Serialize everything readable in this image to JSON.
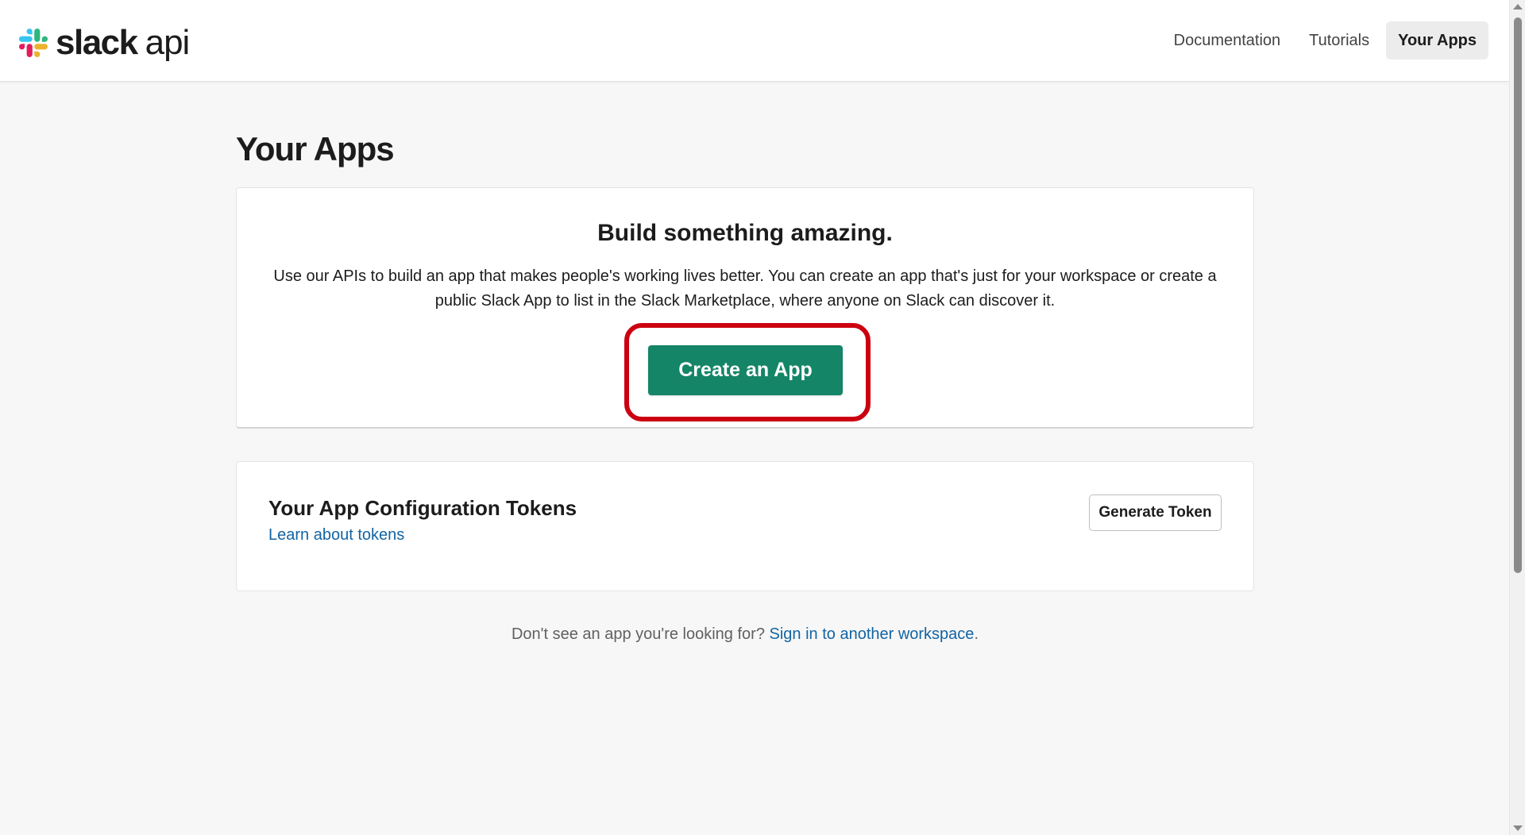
{
  "header": {
    "logo_word": "slack",
    "logo_suffix": "api",
    "nav": [
      {
        "label": "Documentation",
        "active": false
      },
      {
        "label": "Tutorials",
        "active": false
      },
      {
        "label": "Your Apps",
        "active": true
      }
    ]
  },
  "main": {
    "page_title": "Your Apps",
    "build_card": {
      "heading": "Build something amazing.",
      "description": "Use our APIs to build an app that makes people's working lives better. You can create an app that's just for your workspace or create a public Slack App to list in the Slack Marketplace, where anyone on Slack can discover it.",
      "create_button_label": "Create an App"
    },
    "tokens_card": {
      "title": "Your App Configuration Tokens",
      "link_label": "Learn about tokens",
      "generate_button_label": "Generate Token"
    },
    "footer": {
      "prompt": "Don't see an app you're looking for?",
      "link_label": "Sign in to another workspace",
      "suffix": "."
    }
  },
  "colors": {
    "primary_button": "#148567",
    "highlight_ring": "#cc0010",
    "link": "#1264a3",
    "logo_blue": "#36C5F0",
    "logo_green": "#2EB67D",
    "logo_yellow": "#ECB22E",
    "logo_red": "#E01E5A"
  },
  "icons": {
    "logo": "slack-logo-icon"
  }
}
